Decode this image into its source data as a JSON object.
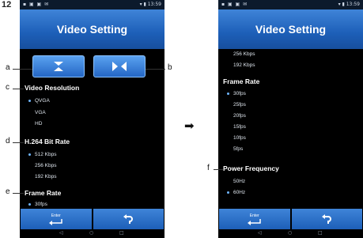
{
  "step_number": "12",
  "arrow": "➡",
  "status_left": "▪ ▣ ▣ ✉",
  "status_right": "▾ ▮ 13:59",
  "title": "Video Setting",
  "flip_vertical_icon": "flip-vertical-icon",
  "flip_horizontal_icon": "flip-horizontal-icon",
  "left_screen": {
    "sections": [
      {
        "label": "Video Resolution",
        "options": [
          "QVGA",
          "VGA",
          "HD"
        ],
        "selected": 0
      },
      {
        "label": "H.264 Bit Rate",
        "options": [
          "512 Kbps",
          "256 Kbps",
          "192 Kbps"
        ],
        "selected": 0
      },
      {
        "label": "Frame Rate",
        "options": [
          "30fps"
        ],
        "selected": 0
      }
    ]
  },
  "right_screen": {
    "continued_options": [
      "256 Kbps",
      "192 Kbps"
    ],
    "sections": [
      {
        "label": "Frame Rate",
        "options": [
          "30fps",
          "25fps",
          "20fps",
          "15fps",
          "10fps",
          "5fps"
        ],
        "selected": 0
      },
      {
        "label": "Power Frequency",
        "options": [
          "50Hz",
          "60Hz"
        ],
        "selected": 1
      }
    ]
  },
  "bottom": {
    "enter_label": "Enter",
    "back_icon": "back-arrow-icon",
    "enter_icon": "enter-icon"
  },
  "nav": {
    "back": "◁",
    "home": "○",
    "recent": "□"
  },
  "callouts": {
    "a": "a",
    "b": "b",
    "c": "c",
    "d": "d",
    "e": "e",
    "f": "f"
  },
  "colors": {
    "title_bar": "#1d5fb8",
    "button": "#2466c4",
    "selected_dot": "#6fb6ff",
    "background": "#000000"
  }
}
